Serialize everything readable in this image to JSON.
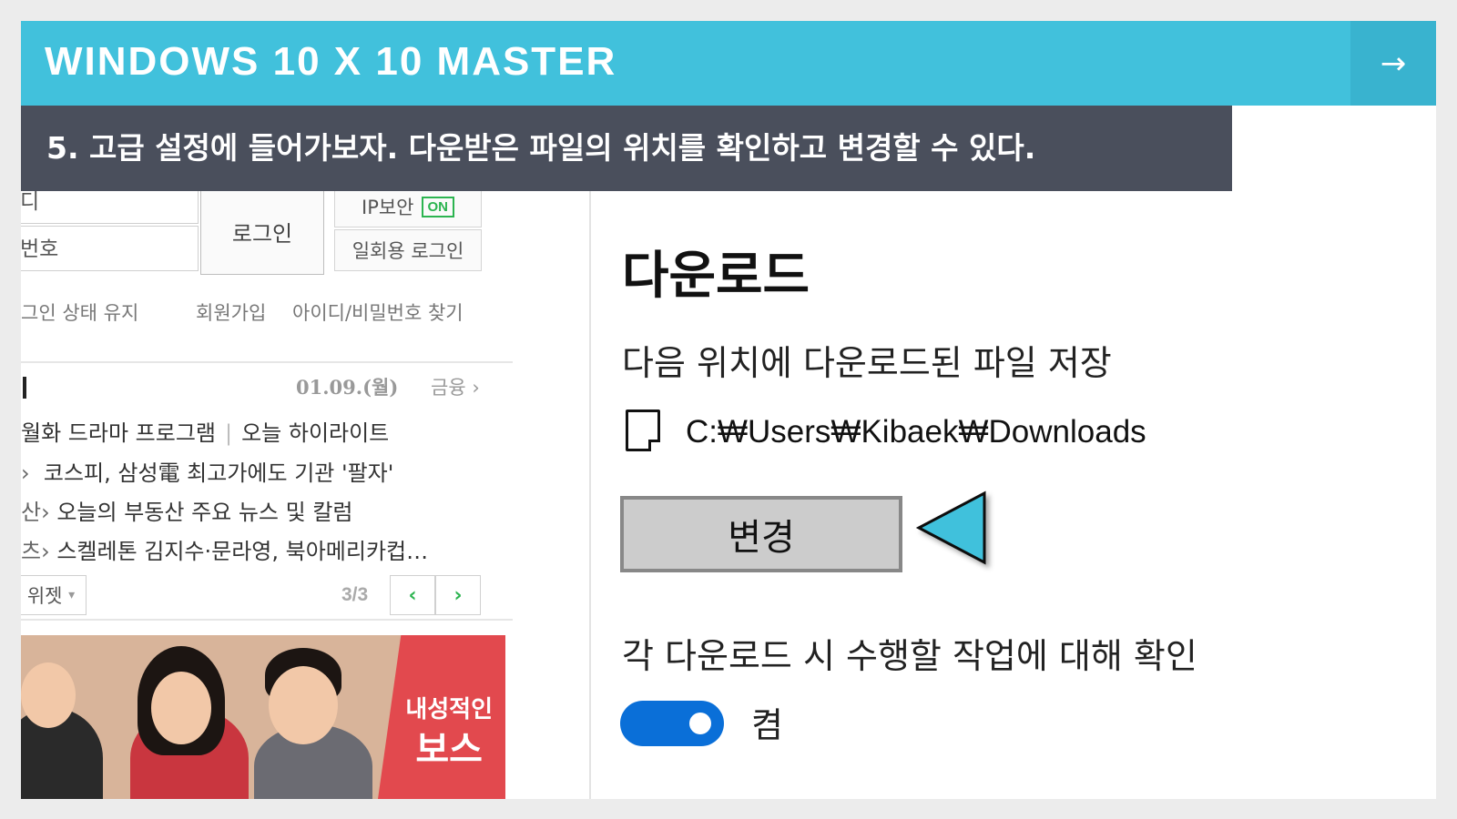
{
  "header": {
    "title": "WINDOWS 10 X 10 MASTER",
    "next_icon": "→"
  },
  "caption": "5. 고급 설정에 들어가보자. 다운받은 파일의 위치를 확인하고 변경할 수 있다.",
  "portal": {
    "id_field": "디",
    "pw_field": "번호",
    "login_button": "로그인",
    "ip_security": "IP보안",
    "ip_badge": "ON",
    "otp_login": "일회용 로그인",
    "keep_login": "그인 상태 유지",
    "signup": "회원가입",
    "find_account": "아이디/비밀번호 찾기",
    "news_date": "01.09.(월)",
    "news_category": "금융",
    "news_category_arrow": "›",
    "news": [
      {
        "prefix": "",
        "text": "월화 드라마 프로그램",
        "extra": "오늘 하이라이트"
      },
      {
        "prefix": "›",
        "text": "코스피, 삼성電 최고가에도 기관 '팔자'",
        "extra": ""
      },
      {
        "prefix": "산›",
        "text": "오늘의 부동산 주요 뉴스 및 칼럼",
        "extra": ""
      },
      {
        "prefix": "츠›",
        "text": "스켈레톤 김지수·문라영, 북아메리카컵…",
        "extra": ""
      }
    ],
    "widget": "위젯",
    "widget_caret": "▾",
    "pager": "3/3",
    "prev_icon": "‹",
    "next_icon": "›",
    "banner_logo_line1": "내성적인",
    "banner_logo_line2": "보스"
  },
  "download": {
    "title": "다운로드",
    "save_label": "다음 위치에 다운로드된 파일 저장",
    "path": "C:₩Users₩Kibaek₩Downloads",
    "change_button": "변경",
    "ask_label": "각 다운로드 시 수행할 작업에 대해 확인",
    "toggle_label": "켬",
    "toggle_state": "on"
  },
  "colors": {
    "header_bg": "#41c1dc",
    "caption_bg": "#4a4f5c",
    "toggle_on": "#0a6fd8",
    "pointer": "#41c1dc",
    "portal_green": "#2cb450"
  }
}
